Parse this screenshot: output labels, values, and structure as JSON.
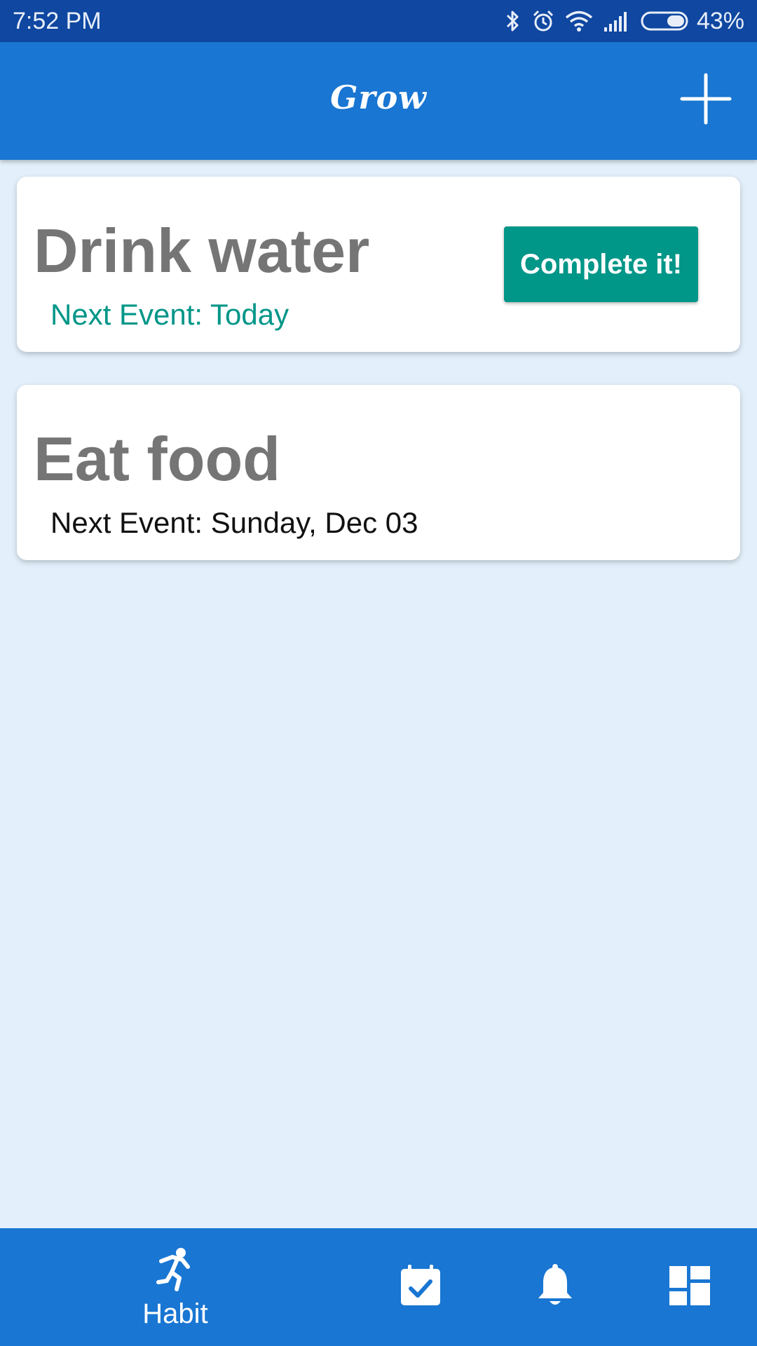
{
  "status_bar": {
    "time": "7:52  PM",
    "battery_percent": "43%",
    "battery_level": 0.43,
    "icons": [
      "bluetooth-icon",
      "alarm-icon",
      "wifi-icon",
      "signal-icon",
      "battery-icon"
    ]
  },
  "app_bar": {
    "title": "Grow",
    "add_icon": "plus-icon"
  },
  "habits": [
    {
      "title": "Drink water",
      "next_event": "Next Event: Today",
      "is_due": true,
      "action_label": "Complete it!"
    },
    {
      "title": "Eat food",
      "next_event": "Next Event: Sunday, Dec 03",
      "is_due": false
    }
  ],
  "bottom_nav": {
    "items": [
      {
        "label": "Habit",
        "icon": "running-person-icon",
        "active": true
      },
      {
        "icon": "calendar-check-icon"
      },
      {
        "icon": "bell-icon"
      },
      {
        "icon": "dashboard-icon"
      }
    ]
  },
  "colors": {
    "primary": "#1976D2",
    "primary_dark": "#0F47A1",
    "accent": "#009688",
    "background": "#E3F0FB",
    "card_title": "#757575"
  }
}
